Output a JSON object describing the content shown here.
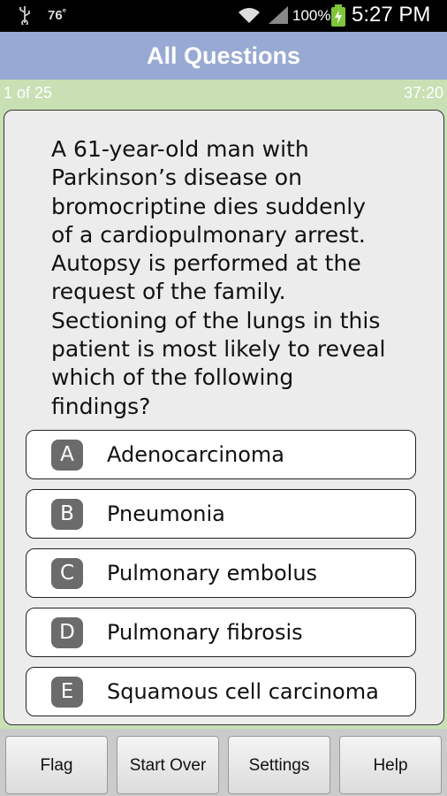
{
  "status_bar": {
    "temperature": "76˚",
    "battery_percent": "100%",
    "time": "5:27 PM",
    "icons": [
      "usb-icon",
      "wifi-icon",
      "signal-icon",
      "battery-charging-icon"
    ]
  },
  "header": {
    "title": "All Questions"
  },
  "progress": {
    "counter": "1 of 25",
    "timer": "37:20"
  },
  "question": {
    "text": "A 61-year-old man with Parkinson’s disease on bromocriptine dies suddenly of a cardiopulmonary arrest. Autopsy is performed at the request of the family. Sectioning of the lungs in this patient is most likely to reveal which of the following findings?"
  },
  "answers": [
    {
      "letter": "A",
      "text": "Adenocarcinoma"
    },
    {
      "letter": "B",
      "text": "Pneumonia"
    },
    {
      "letter": "C",
      "text": "Pulmonary embolus"
    },
    {
      "letter": "D",
      "text": "Pulmonary fibrosis"
    },
    {
      "letter": "E",
      "text": "Squamous cell carcinoma"
    }
  ],
  "toolbar": {
    "flag_label": "Flag",
    "start_over_label": "Start Over",
    "settings_label": "Settings",
    "help_label": "Help"
  },
  "colors": {
    "header_bg": "#98a9d3",
    "progress_bg": "#c8e0b4",
    "letter_badge": "#6b6b6b"
  }
}
